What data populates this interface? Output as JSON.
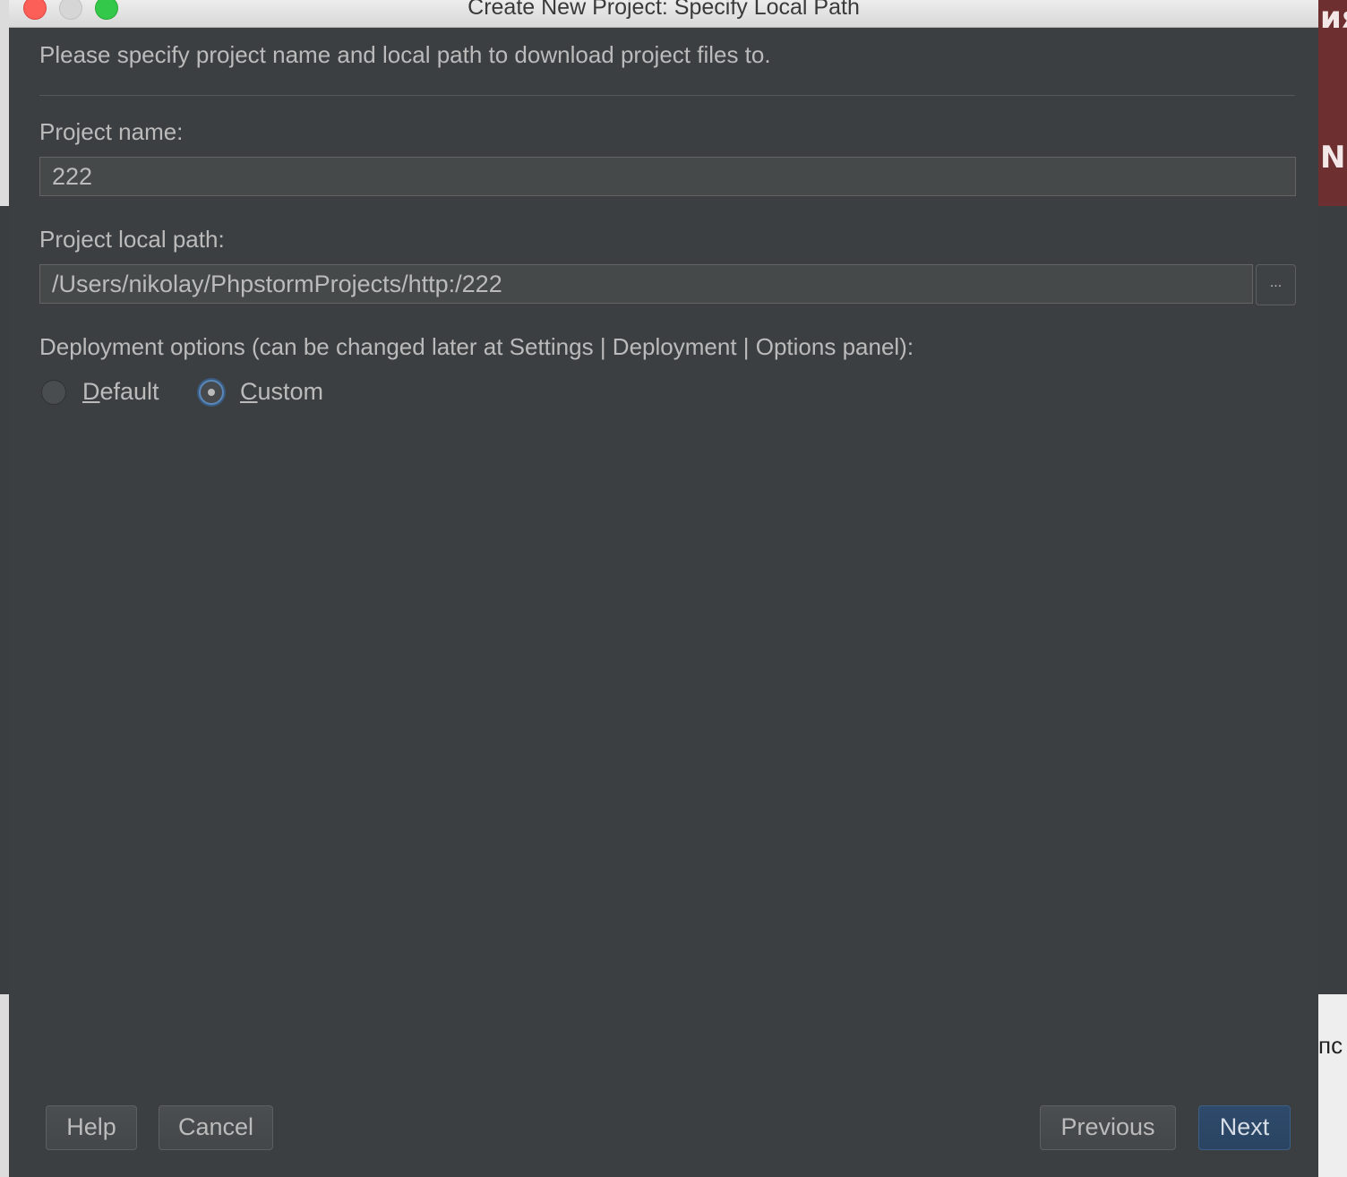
{
  "window": {
    "title": "Create New Project: Specify Local Path",
    "controls": [
      "close",
      "minimize",
      "maximize"
    ]
  },
  "intro_text": "Please specify project name and local path to download project files to.",
  "project_name": {
    "label": "Project name:",
    "value": "222"
  },
  "project_path": {
    "label": "Project local path:",
    "value": "/Users/nikolay/PhpstormProjects/http:/222",
    "browse_label": "..."
  },
  "deployment": {
    "label": "Deployment options (can be changed later at Settings | Deployment | Options panel):",
    "options": [
      {
        "label_prefix": "",
        "mnemonic": "D",
        "label_rest": "efault",
        "selected": false
      },
      {
        "label_prefix": "",
        "mnemonic": "C",
        "label_rest": "ustom",
        "selected": true
      }
    ]
  },
  "buttons": {
    "help": "Help",
    "cancel": "Cancel",
    "previous": "Previous",
    "next": "Next"
  },
  "background": {
    "right_top_text": "ия",
    "right_mid_text": "ND",
    "right_bottom_text": "пс"
  },
  "colors": {
    "window_bg": "#3c3f41",
    "text": "#bbbbbb",
    "field_bg": "#45494a",
    "accent": "#5b87b8",
    "default_button": "#2e4a6b"
  }
}
